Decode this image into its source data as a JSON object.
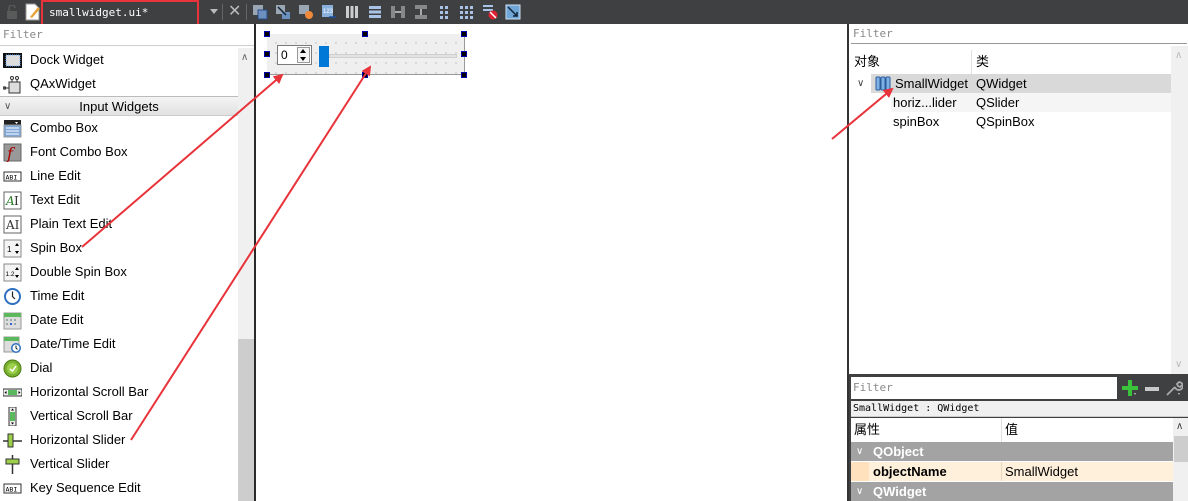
{
  "toolbar": {
    "file_name": "smallwidget.ui*",
    "icons": [
      "lock-icon",
      "edit-document-icon",
      "dropdown-icon",
      "close-icon",
      "edit-widgets-icon",
      "edit-signals-slots-icon",
      "edit-buddies-icon",
      "edit-tab-order-icon",
      "layout-horizontal-icon",
      "layout-vertical-icon",
      "layout-horizontal-splitter-icon",
      "layout-vertical-splitter-icon",
      "layout-form-icon",
      "layout-grid-icon",
      "break-layout-icon",
      "adjust-size-icon"
    ]
  },
  "widget_box": {
    "filter_placeholder": "Filter",
    "items_before": [
      {
        "label": "Dock Widget",
        "icon": "dock-widget-icon"
      },
      {
        "label": "QAxWidget",
        "icon": "qaxwidget-icon"
      }
    ],
    "category": "Input Widgets",
    "items": [
      {
        "label": "Combo Box",
        "icon": "combo-box-icon"
      },
      {
        "label": "Font Combo Box",
        "icon": "font-combo-box-icon"
      },
      {
        "label": "Line Edit",
        "icon": "line-edit-icon"
      },
      {
        "label": "Text Edit",
        "icon": "text-edit-icon"
      },
      {
        "label": "Plain Text Edit",
        "icon": "plain-text-edit-icon"
      },
      {
        "label": "Spin Box",
        "icon": "spin-box-icon"
      },
      {
        "label": "Double Spin Box",
        "icon": "double-spin-box-icon"
      },
      {
        "label": "Time Edit",
        "icon": "time-edit-icon"
      },
      {
        "label": "Date Edit",
        "icon": "date-edit-icon"
      },
      {
        "label": "Date/Time Edit",
        "icon": "date-time-edit-icon"
      },
      {
        "label": "Dial",
        "icon": "dial-icon"
      },
      {
        "label": "Horizontal Scroll Bar",
        "icon": "horizontal-scroll-bar-icon"
      },
      {
        "label": "Vertical Scroll Bar",
        "icon": "vertical-scroll-bar-icon"
      },
      {
        "label": "Horizontal Slider",
        "icon": "horizontal-slider-icon"
      },
      {
        "label": "Vertical Slider",
        "icon": "vertical-slider-icon"
      },
      {
        "label": "Key Sequence Edit",
        "icon": "key-sequence-edit-icon"
      }
    ]
  },
  "form": {
    "spinbox_value": "0",
    "slider_value_fraction": 0.0,
    "accent": "#0078d7"
  },
  "object_inspector": {
    "filter_placeholder": "Filter",
    "col_object": "对象",
    "col_class": "类",
    "rows": [
      {
        "object": "SmallWidget",
        "class": "QWidget",
        "level": 0,
        "selected": true
      },
      {
        "object": "horiz...lider",
        "class": "QSlider",
        "level": 1,
        "selected": false
      },
      {
        "object": "spinBox",
        "class": "QSpinBox",
        "level": 1,
        "selected": false
      }
    ]
  },
  "property_editor": {
    "filter_placeholder": "Filter",
    "class_label": "SmallWidget : QWidget",
    "col_property": "属性",
    "col_value": "值",
    "group1": "QObject",
    "row1_name": "objectName",
    "row1_value": "SmallWidget",
    "group2": "QWidget"
  },
  "colors": {
    "annotation_red": "#e8333a",
    "toolbar_bg": "#3f4042",
    "selection_bg": "#d9d9d9",
    "property_highlight": "#fff0dc",
    "group_bg": "#a3a3a3"
  }
}
